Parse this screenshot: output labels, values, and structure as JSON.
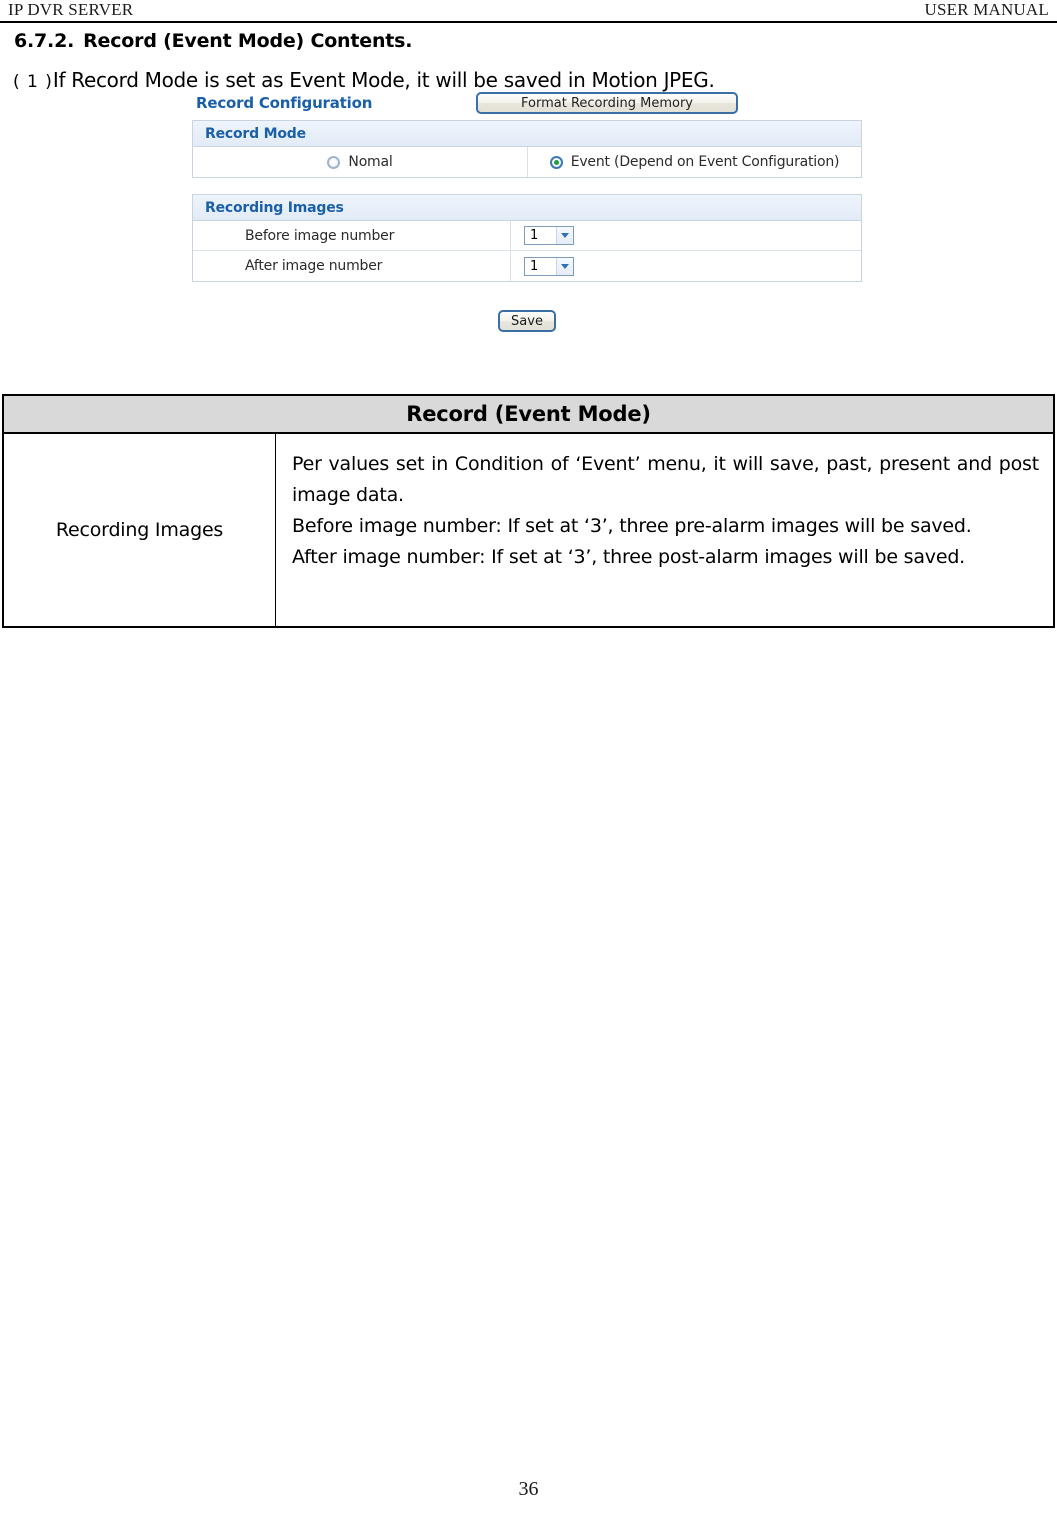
{
  "header": {
    "left": "IP DVR SERVER",
    "right": "USER MANUAL"
  },
  "section": {
    "number": "6.7.2.",
    "title": "Record (Event Mode) Contents."
  },
  "intro": {
    "enumerator": "( 1 )",
    "text": "If Record Mode is set as Event Mode, it will be saved in Motion JPEG."
  },
  "app_screenshot": {
    "title": "Record Configuration",
    "format_button": "Format Recording Memory",
    "record_mode": {
      "panel_header": "Record Mode",
      "options": [
        {
          "label": "Nomal",
          "selected": false
        },
        {
          "label": "Event (Depend on Event Configuration)",
          "selected": true
        }
      ]
    },
    "recording_images": {
      "panel_header": "Recording Images",
      "rows": [
        {
          "label": "Before image number",
          "value": "1"
        },
        {
          "label": "After image number",
          "value": "1"
        }
      ]
    },
    "save_button": "Save"
  },
  "desc_table": {
    "header": "Record (Event Mode)",
    "key": "Recording Images",
    "paragraphs": [
      "Per values set in Condition of ‘Event’ menu, it will save, past, present and post image data.",
      "Before image number: If set at ‘3’, three pre-alarm images will be saved.",
      "After image number: If set at ‘3’, three post-alarm images will be saved."
    ]
  },
  "footer": {
    "page_number": "36"
  },
  "colors": {
    "panel_header_text": "#1a5fa8",
    "button_border": "#3a6ea5",
    "radio_selected_dot": "#1fa03c",
    "table_header_bg": "#d9d9d9"
  }
}
